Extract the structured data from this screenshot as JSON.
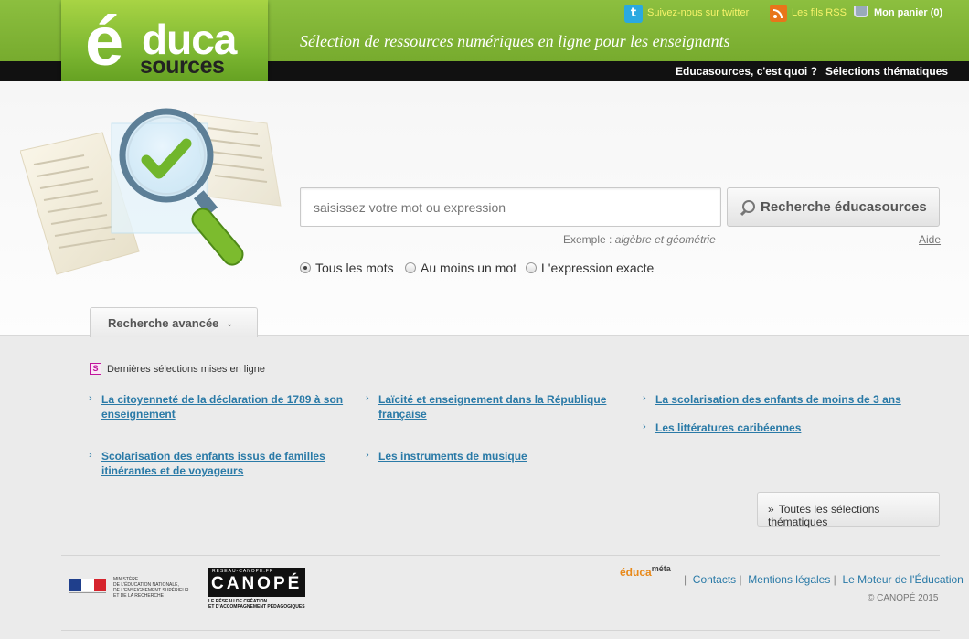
{
  "header": {
    "logo_e": "é",
    "logo_duca": "duca",
    "logo_sources": "sources",
    "tagline": "Sélection de ressources numériques en ligne pour les enseignants",
    "twitter_label": "Suivez-nous sur twitter",
    "rss_label": "Les fils RSS",
    "basket_label": "Mon panier (0)",
    "nav": [
      "Educasources, c'est quoi ?",
      "Sélections thématiques"
    ]
  },
  "search": {
    "placeholder": "saisissez votre mot ou expression",
    "button_label": "Recherche éducasources",
    "example_prefix": "Exemple :",
    "example_value": "algèbre et géométrie",
    "help_label": "Aide",
    "modes": [
      "Tous les mots",
      "Au moins un mot",
      "L'expression exacte"
    ],
    "selected_mode": "Tous les mots",
    "advanced_label": "Recherche avancée"
  },
  "selections": {
    "title": "Dernières sélections mises en ligne",
    "icon_letter": "S",
    "items": [
      "La citoyenneté de la déclaration de 1789 à son enseignement",
      "Laïcité et enseignement dans la République française",
      "La scolarisation des enfants de moins de 3 ans",
      "Les littératures caribéennes",
      "Scolarisation des enfants issus de familles itinérantes et de voyageurs",
      "Les instruments de musique"
    ],
    "all_label": "Toutes les sélections thématiques"
  },
  "footer": {
    "ministry": [
      "MINISTÈRE",
      "DE L'ÉDUCATION NATIONALE,",
      "DE L'ENSEIGNEMENT SUPÉRIEUR",
      "ET DE LA RECHERCHE"
    ],
    "canope_top": "RESEAU-CANOPE.FR",
    "canope_name": "CANOPÉ",
    "canope_sub1": "LE RÉSEAU DE CRÉATION",
    "canope_sub2": "ET D'ACCOMPAGNEMENT PÉDAGOGIQUES",
    "educameta_main": "éduca",
    "educameta_sup": "méta",
    "links": [
      "Contacts",
      "Mentions légales",
      "Le Moteur de l'Éducation"
    ],
    "copyright": "© CANOPÉ 2015"
  },
  "colors": {
    "header_green": "#7fb336",
    "link_blue": "#2a7aa7",
    "accent_orange": "#e8891a"
  }
}
